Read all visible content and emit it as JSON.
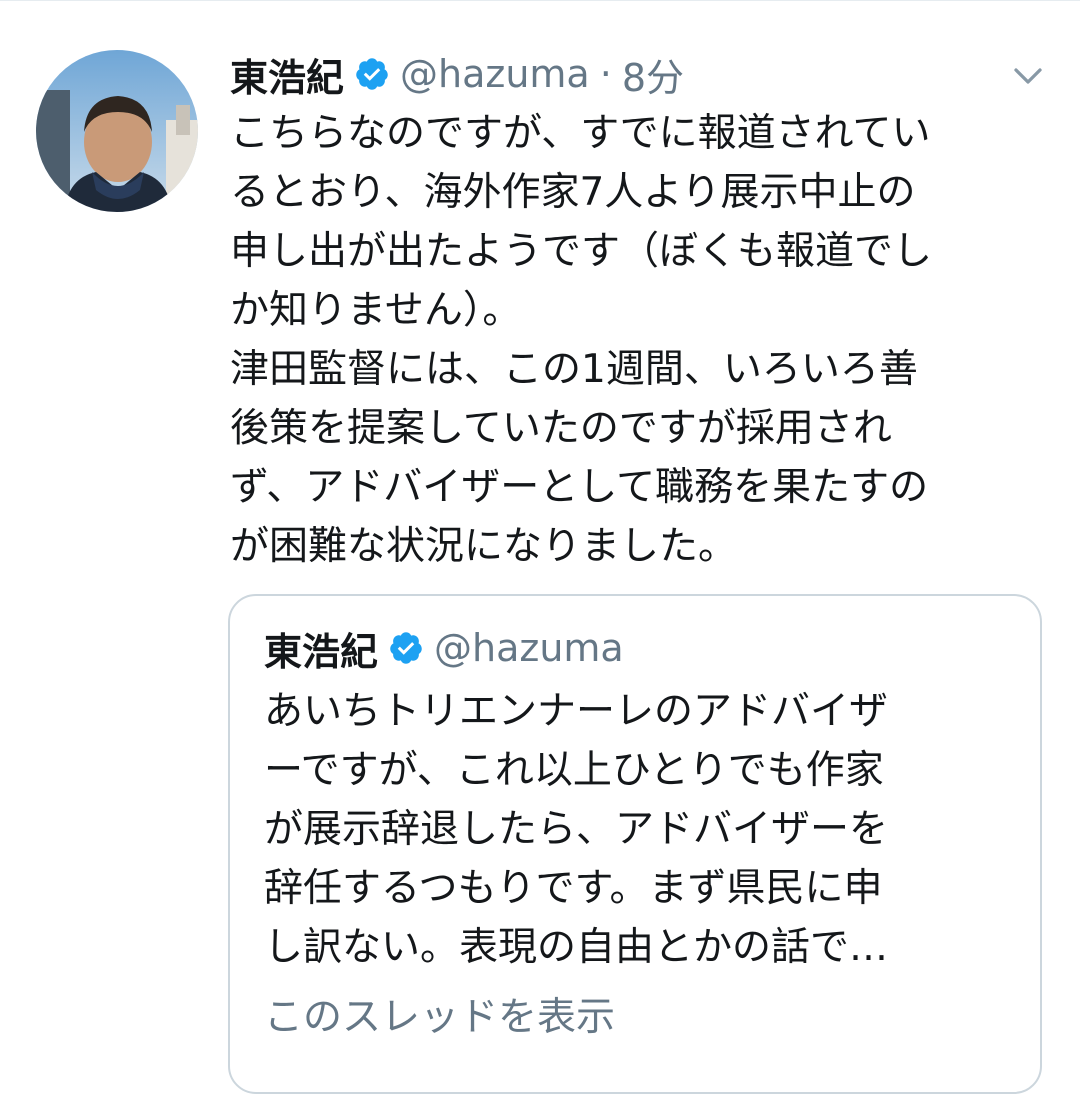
{
  "tweet": {
    "author_name": "東浩紀",
    "handle": "@hazuma",
    "separator": "·",
    "time": "8分",
    "text_lines": [
      "こちらなのですが、すでに報道されてい",
      "るとおり、海外作家7人より展示中止の",
      "申し出が出たようです（ぼくも報道でし",
      "か知りません）。",
      "津田監督には、この1週間、いろいろ善",
      "後策を提案していたのですが採用され",
      "ず、アドバイザーとして職務を果たすの",
      "が困難な状況になりました。"
    ]
  },
  "quoted_tweet": {
    "author_name": "東浩紀",
    "handle": "@hazuma",
    "text_lines": [
      "あいちトリエンナーレのアドバイザ",
      "ーですが、これ以上ひとりでも作家",
      "が展示辞退したら、アドバイザーを",
      "辞任するつもりです。まず県民に申",
      "し訳ない。表現の自由とかの話で…"
    ],
    "show_thread_label": "このスレッドを表示"
  },
  "icons": {
    "verified": "verified-badge-icon",
    "menu": "chevron-down-icon",
    "avatar": "profile-photo"
  },
  "colors": {
    "verified": "#1da1f2",
    "secondary_text": "#657786",
    "primary_text": "#14171a",
    "border": "#ccd6dd"
  }
}
